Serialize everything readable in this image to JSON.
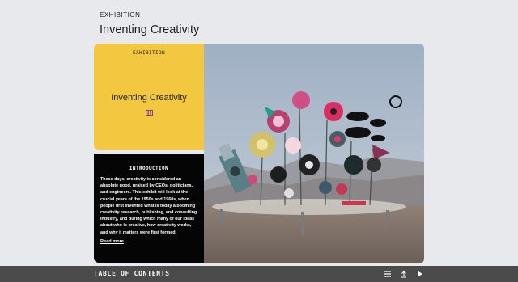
{
  "header": {
    "eyebrow": "EXHIBITION",
    "title": "Inventing Creativity"
  },
  "cover_card": {
    "kicker": "EXHIBITION",
    "title": "Inventing Creativity",
    "emblem_icon": "museum-emblem-icon",
    "background": "#f3c840"
  },
  "intro_card": {
    "heading": "INTRODUCTION",
    "body": "These days, creativity is considered an absolute good, praised by CEOs, politicians, and engineers. This exhibit will look at the crucial years of the 1950s and 1960s, when people first invented what is today a booming creativity research, publishing, and consulting industry, and during which many of our ideas about who is creative, how creativity works, and why it matters were first formed.",
    "read_more": "Read more"
  },
  "bottom_bar": {
    "label": "TABLE OF CONTENTS",
    "icons": [
      "list-icon",
      "share-icon",
      "play-icon"
    ]
  },
  "colors": {
    "page": "#e8e9ec",
    "bar": "#4b4b4b",
    "dark_card": "#050505"
  }
}
